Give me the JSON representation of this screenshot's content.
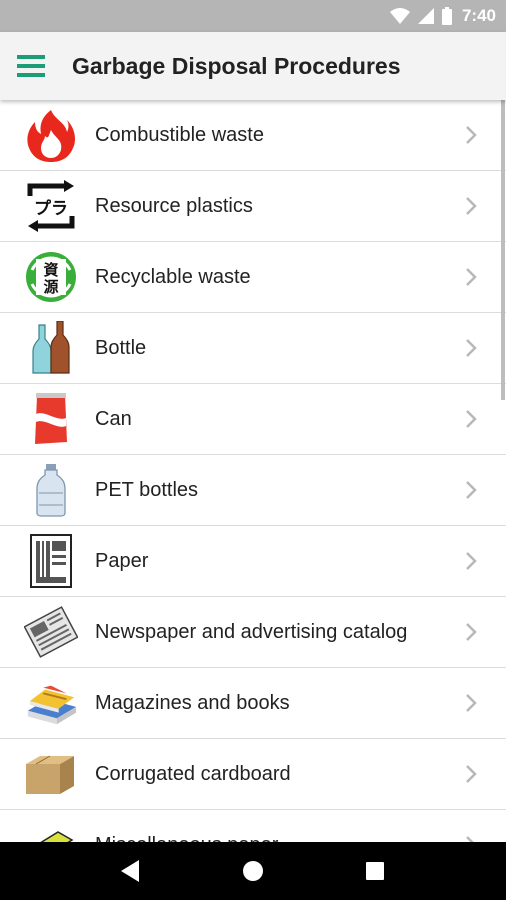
{
  "status_bar": {
    "time": "7:40",
    "icons": [
      "wifi-icon",
      "signal-icon",
      "battery-icon"
    ]
  },
  "app_bar": {
    "title": "Garbage Disposal Procedures",
    "menu_icon": "hamburger-menu-icon"
  },
  "items": [
    {
      "label": "Combustible waste",
      "icon": "fire-icon"
    },
    {
      "label": "Resource plastics",
      "icon": "plastic-recycle-icon",
      "icon_text": "プラ"
    },
    {
      "label": "Recyclable waste",
      "icon": "resource-recycle-icon",
      "icon_text": [
        "資",
        "源"
      ]
    },
    {
      "label": "Bottle",
      "icon": "bottles-icon"
    },
    {
      "label": "Can",
      "icon": "can-icon"
    },
    {
      "label": "PET bottles",
      "icon": "pet-bottle-icon"
    },
    {
      "label": "Paper",
      "icon": "paper-icon"
    },
    {
      "label": "Newspaper and advertising catalog",
      "icon": "newspaper-icon"
    },
    {
      "label": "Magazines and books",
      "icon": "magazines-icon"
    },
    {
      "label": "Corrugated cardboard",
      "icon": "cardboard-box-icon"
    },
    {
      "label": "Miscellaneous paper",
      "icon": "misc-paper-icon"
    }
  ],
  "nav_bar": {
    "buttons": [
      "back-icon",
      "home-icon",
      "recents-icon"
    ]
  },
  "colors": {
    "status_bar": "#b5b5b5",
    "app_bar": "#f3f3f3",
    "menu_icon": "#1a9e77",
    "chevron": "#b8b8b8"
  }
}
